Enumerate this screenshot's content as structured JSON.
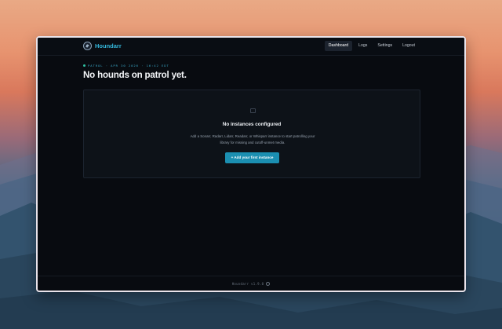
{
  "app": {
    "brand": "Houndarr",
    "logo_icon": "hound-logo-icon"
  },
  "nav": {
    "items": [
      {
        "label": "Dashboard",
        "active": true
      },
      {
        "label": "Logs",
        "active": false
      },
      {
        "label": "Settings",
        "active": false
      },
      {
        "label": "Logout",
        "active": false
      }
    ]
  },
  "status": {
    "eyebrow": "PATROL · APR 30 2026 · 16:42 EDT",
    "title": "No hounds on patrol yet."
  },
  "empty_state": {
    "icon": "empty-box-icon",
    "title": "No instances configured",
    "description": "Add a Sonarr, Radarr, Lidarr, Readarr, or Whisparr instance to start patrolling your library for missing and cutoff-unmet media.",
    "button_label": "+ Add your first instance"
  },
  "footer": {
    "version": "Houndarr v1.9.0",
    "icon": "github-icon"
  },
  "colors": {
    "accent": "#35b8dc",
    "button": "#1b8fb1",
    "background": "#080b10",
    "card": "#0d1218"
  }
}
